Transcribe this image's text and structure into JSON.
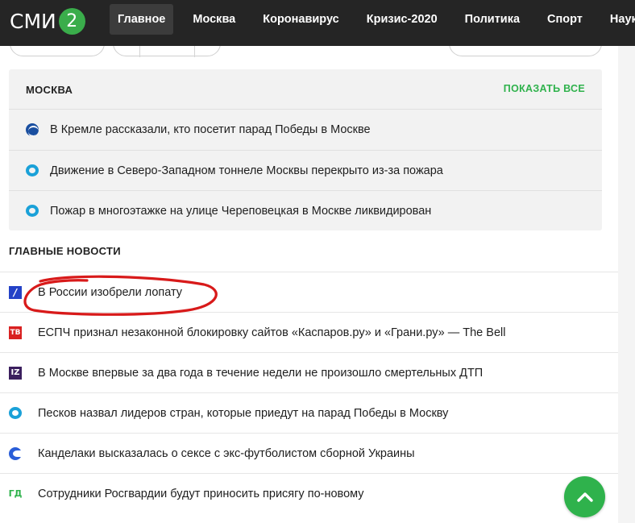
{
  "header": {
    "logo_text": "СМИ",
    "logo_number": "2",
    "nav": [
      {
        "label": "Главное",
        "active": true
      },
      {
        "label": "Москва",
        "active": false
      },
      {
        "label": "Коронавирус",
        "active": false
      },
      {
        "label": "Кризис-2020",
        "active": false
      },
      {
        "label": "Политика",
        "active": false
      },
      {
        "label": "Спорт",
        "active": false
      },
      {
        "label": "Наук",
        "active": false
      }
    ]
  },
  "moscow": {
    "title": "МОСКВА",
    "show_all": "ПОКАЗАТЬ ВСЕ",
    "items": [
      {
        "icon": "globe-source-icon",
        "text": "В Кремле рассказали, кто посетит парад Победы в Москве"
      },
      {
        "icon": "ring-source-icon",
        "text": "Движение в Северо-Западном тоннеле Москвы перекрыто из-за пожара"
      },
      {
        "icon": "ring-source-icon",
        "text": "Пожар в многоэтажке на улице Череповецкая в Москве ликвидирован"
      }
    ]
  },
  "main_news": {
    "title": "ГЛАВНЫЕ НОВОСТИ",
    "items": [
      {
        "icon": "slash-source-icon",
        "badge": "/",
        "text": "В России изобрели лопату"
      },
      {
        "icon": "tv-source-icon",
        "badge": "ТВ",
        "text": "ЕСПЧ признал незаконной блокировку сайтов «Каспаров.ру» и «Грани.ру» — The Bell"
      },
      {
        "icon": "iz-source-icon",
        "badge": "IZ",
        "text": "В Москве впервые за два года в течение недели не произошло смертельных ДТП"
      },
      {
        "icon": "ring-source-icon",
        "badge": "",
        "text": "Песков назвал лидеров стран, которые приедут на парад Победы в Москву"
      },
      {
        "icon": "c-source-icon",
        "badge": "",
        "text": "Канделаки высказалась о сексе с экс-футболистом сборной Украины"
      },
      {
        "icon": "gd-source-icon",
        "badge": "ГД",
        "text": "Сотрудники Росгвардии будут приносить присягу по-новому"
      }
    ]
  },
  "colors": {
    "accent_green": "#2fb24c",
    "topbar": "#252525",
    "annotation_red": "#d81a1a"
  }
}
